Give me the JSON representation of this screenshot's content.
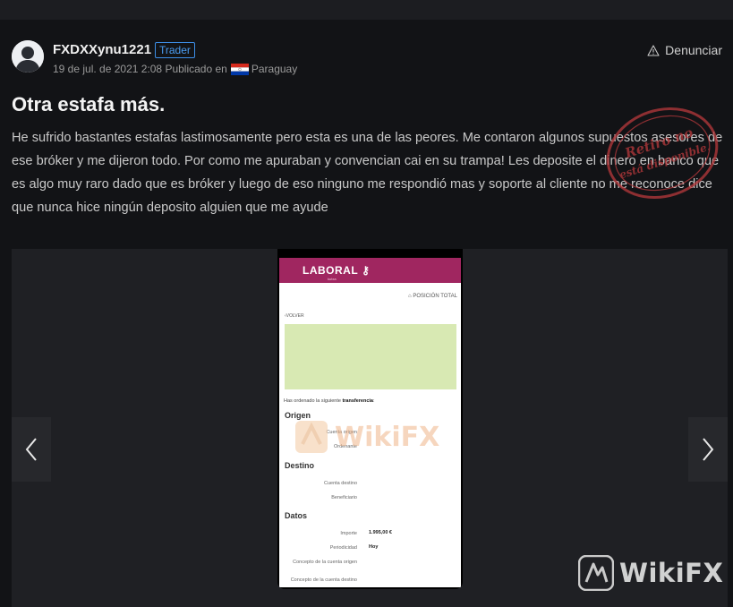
{
  "post": {
    "username": "FXDXXynu1221",
    "badge": "Trader",
    "date": "19 de jul. de 2021 2:08",
    "published_in": "Publicado en",
    "country": "Paraguay",
    "report_label": "Denunciar",
    "title": "Otra estafa más.",
    "body": "He sufrido bastantes estafas lastimosamente pero esta es una de las peores. Me contaron algunos supuestos asesores de ese bróker y me dijeron todo. Por como me apuraban y convencian cai en su trampa! Les deposite el dinero en banco que es algo muy raro dado que es bróker y luego de eso ninguno me respondió mas y soporte al cliente no me reconoce dice que nunca hice ningún deposito alguien que me ayude",
    "stamp_text": "Retiro no está disponible."
  },
  "screenshot": {
    "brand": "LABORAL",
    "brand_sub": "kutxa",
    "position_total": "POSICIÓN TOTAL",
    "back": "VOLVER",
    "ordered_prefix": "Has ordenado la siguiente",
    "ordered_bold": "transferencia",
    "ordered_suffix": ":",
    "origin_title": "Origen",
    "origin_account": "Cuenta origen",
    "origin_orderer": "Ordenante",
    "dest_title": "Destino",
    "dest_account": "Cuenta destino",
    "dest_beneficiary": "Beneficiario",
    "data_title": "Datos",
    "amount_label": "Importe",
    "amount_value": "1.995,00 €",
    "periodicity_label": "Periodicidad",
    "periodicity_value": "Hoy",
    "concept_origin_label": "Concepto de la cuenta origen",
    "concept_dest_label": "Concepto de la cuenta destino"
  },
  "watermark": {
    "text": "WikiFX"
  },
  "colors": {
    "background": "#121316",
    "badge_blue": "#4b9cf0",
    "brand_magenta": "#a02660",
    "stamp_red": "#b8393c",
    "green_box": "#d8e9b3"
  },
  "icons": {
    "report": "warning-triangle-icon",
    "prev": "chevron-left-icon",
    "next": "chevron-right-icon",
    "avatar": "user-silhouette-icon"
  }
}
